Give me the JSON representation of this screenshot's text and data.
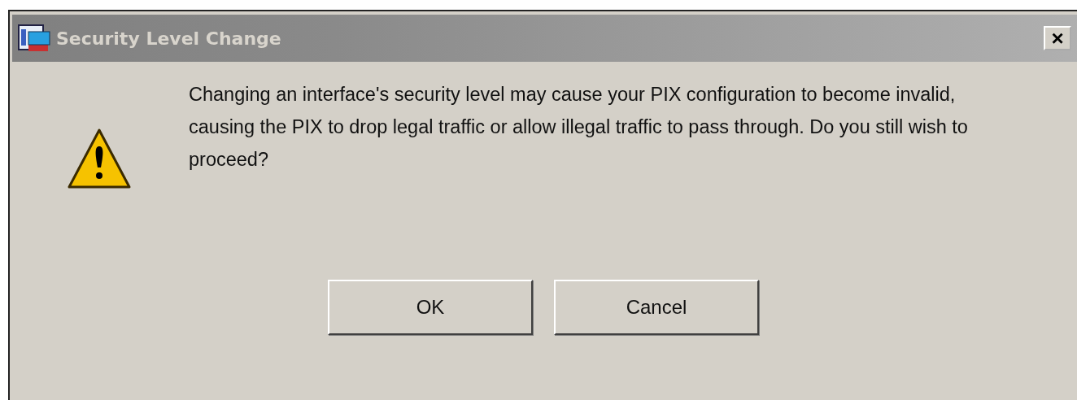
{
  "window": {
    "title": "Security Level Change",
    "close_button": "×"
  },
  "message": "Changing an interface's security level may cause your PIX configuration to become invalid, causing the PIX to drop legal traffic or allow illegal traffic to pass through. Do you still wish to proceed?",
  "buttons": [
    "OK",
    "Cancel"
  ]
}
